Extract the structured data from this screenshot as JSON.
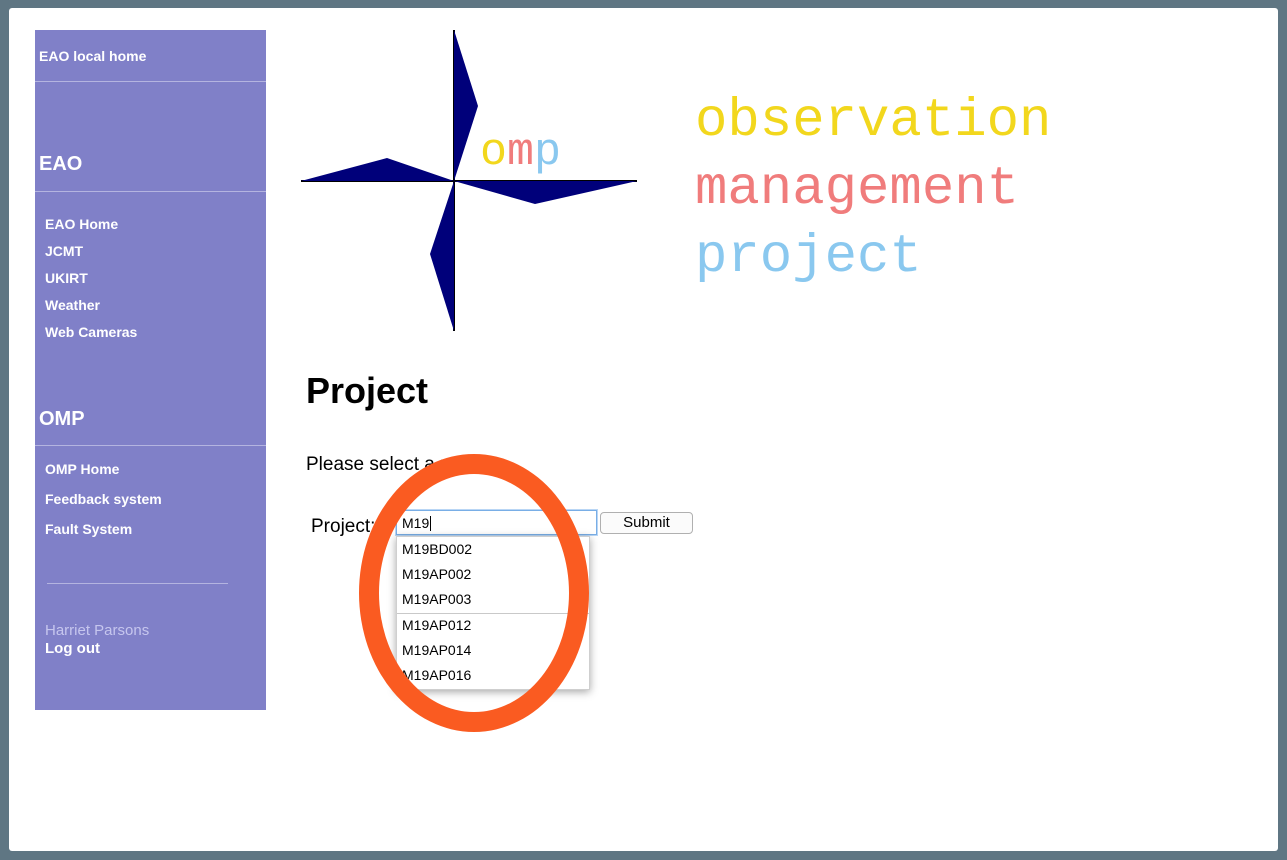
{
  "sidebar": {
    "top_link": "EAO local home",
    "eao_heading": "EAO",
    "eao_items": [
      "EAO Home",
      "JCMT",
      "UKIRT",
      "Weather",
      "Web Cameras"
    ],
    "omp_heading": "OMP",
    "omp_items": [
      "OMP Home",
      "Feedback system",
      "Fault System"
    ],
    "user_name": "Harriet Parsons",
    "logout_label": "Log out",
    "bg_color": "#8080c8"
  },
  "logo": {
    "text": "omp",
    "banner_lines": [
      "observation",
      "management",
      "project"
    ],
    "colors": {
      "observation": "#f2d71d",
      "management": "#f07c7c",
      "project": "#8ac8ef",
      "star": "#00007a"
    }
  },
  "main": {
    "title": "Project",
    "intro": "Please select a project",
    "project_label": "Project:",
    "input_value": "M19",
    "submit_label": "Submit",
    "suggestions": [
      "M19BD002",
      "M19AP002",
      "M19AP003",
      "M19AP012",
      "M19AP014",
      "M19AP016"
    ]
  },
  "annotation": {
    "ring_color": "#fa5b21"
  }
}
